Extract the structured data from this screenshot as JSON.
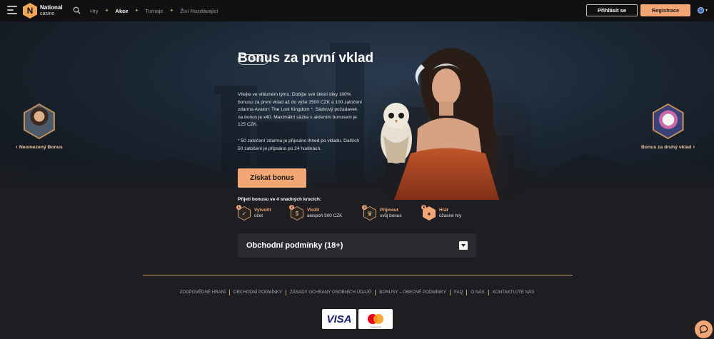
{
  "header": {
    "logo_letter": "N",
    "logo_line1": "National",
    "logo_line2": "casino",
    "nav": [
      "Hry",
      "Akce",
      "Turnaje",
      "Živí Rozdávající"
    ],
    "login_label": "Přihlásit se",
    "register_label": "Registrace"
  },
  "hero": {
    "back_label": "Zadní",
    "title": "Bonus za první vklad",
    "description": "Vítejte ve vítězném týmu. Dobijte své štěstí díky 100% bonusu za první vklad až do výše 2500 CZK a 100 zatočení zdarma Avalon: The Lost Kingdom *. Sázkový požadavek na bonus je x40. Maximální sázka s aktivním bonusem je 125 CZK.",
    "note": "* 50 zatočení zdarma je připsáno ihned po vkladu. Dalších 50 zatočení je připsáno po 24 hodinách.",
    "cta_label": "Získat bonus"
  },
  "side": {
    "left_label": "Neomezený Bonus",
    "right_label": "Bonus za druhý vklad"
  },
  "steps": {
    "title": "Přijetí bonusu ve 4 snadných krocích:",
    "items": [
      {
        "num": "1",
        "line1": "Vytvořit",
        "line2": "účet",
        "icon": "check-icon"
      },
      {
        "num": "2",
        "line1": "Vložit",
        "line2": "alespoň 500 CZK",
        "icon": "coin-icon"
      },
      {
        "num": "3",
        "line1": "Přijmout",
        "line2": "svůj bonus",
        "icon": "gift-icon"
      },
      {
        "num": "4",
        "line1": "Hrát",
        "line2": "úžasné hry",
        "icon": "cards-icon"
      }
    ]
  },
  "terms": {
    "label": "Obchodní podmínky (18+)"
  },
  "footer": {
    "links": [
      "ZODPOVĚDNÉ HRANÍ",
      "OBCHODNÍ PODMÍNKY",
      "ZÁSADY OCHRANY OSOBNÍCH ÚDAJŮ",
      "BONUSY – OBECNÉ PODMÍNKY",
      "FAQ",
      "O NÁS",
      "KONTAKTUJTE NÁS"
    ],
    "visa_label": "VISA",
    "mastercard_label": "mastercard"
  },
  "colors": {
    "accent": "#f2a674",
    "gold": "#c49a6c",
    "background": "#1e1e22",
    "header": "#111114"
  }
}
